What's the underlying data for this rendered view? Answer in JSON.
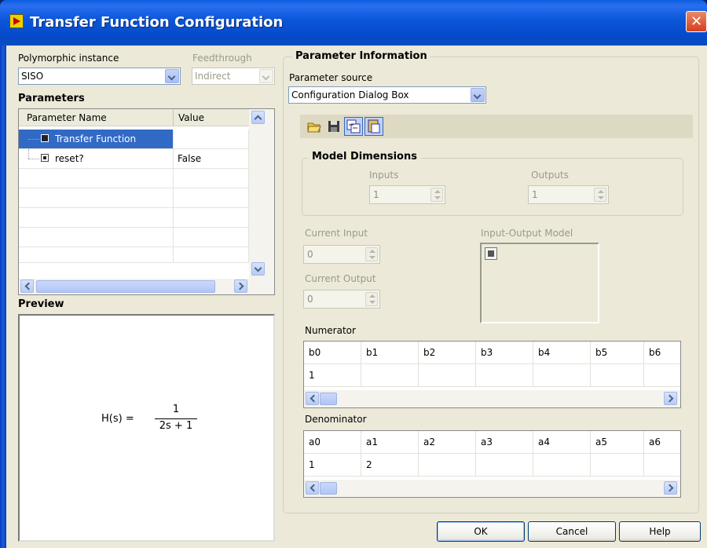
{
  "window": {
    "title": "Transfer Function Configuration",
    "close_glyph": "✕"
  },
  "left": {
    "polymorphic_label": "Polymorphic instance",
    "polymorphic_value": "SISO",
    "feedthrough_label": "Feedthrough",
    "feedthrough_value": "Indirect",
    "parameters_heading": "Parameters",
    "table": {
      "col_name": "Parameter Name",
      "col_value": "Value",
      "rows": [
        {
          "name": "Transfer Function",
          "value": ""
        },
        {
          "name": "reset?",
          "value": "False"
        }
      ]
    },
    "preview_heading": "Preview",
    "preview_equation": {
      "lhs": "H(s) =",
      "numerator": "1",
      "denominator": "2s + 1"
    }
  },
  "right": {
    "group_title": "Parameter Information",
    "source_label": "Parameter source",
    "source_value": "Configuration Dialog Box",
    "model_dimensions": {
      "title": "Model Dimensions",
      "inputs_label": "Inputs",
      "inputs_value": "1",
      "outputs_label": "Outputs",
      "outputs_value": "1"
    },
    "current_input_label": "Current Input",
    "current_input_value": "0",
    "current_output_label": "Current Output",
    "current_output_value": "0",
    "io_model_label": "Input-Output Model",
    "numerator": {
      "label": "Numerator",
      "headers": [
        "b0",
        "b1",
        "b2",
        "b3",
        "b4",
        "b5",
        "b6"
      ],
      "values": [
        "1",
        "",
        "",
        "",
        "",
        "",
        ""
      ]
    },
    "denominator": {
      "label": "Denominator",
      "headers": [
        "a0",
        "a1",
        "a2",
        "a3",
        "a4",
        "a5",
        "a6"
      ],
      "values": [
        "1",
        "2",
        "",
        "",
        "",
        "",
        ""
      ]
    }
  },
  "buttons": {
    "ok": "OK",
    "cancel": "Cancel",
    "help": "Help"
  },
  "icons": [
    "open-folder-icon",
    "save-icon",
    "copy-to-io-icon",
    "paste-io-icon"
  ],
  "colors": {
    "title_bar": "#0a55d8",
    "selection": "#316ac5",
    "dialog_bg": "#ece9d8"
  }
}
